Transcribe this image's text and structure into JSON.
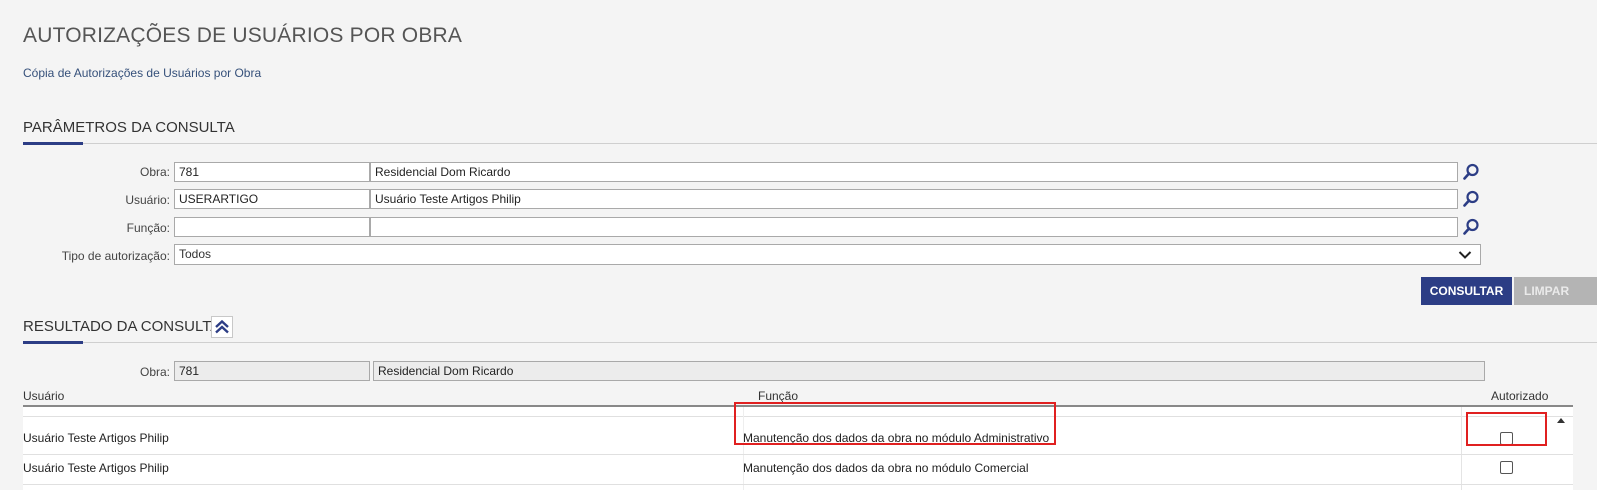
{
  "header": {
    "title": "AUTORIZAÇÕES DE USUÁRIOS POR OBRA",
    "subtitle_link": "Cópia de Autorizações de Usuários por Obra"
  },
  "params": {
    "section_title": "PARÂMETROS DA CONSULTA",
    "obra": {
      "label": "Obra:",
      "code": "781",
      "description": "Residencial Dom Ricardo"
    },
    "usuario": {
      "label": "Usuário:",
      "code": "USERARTIGO",
      "description": "Usuário Teste Artigos Philip"
    },
    "funcao": {
      "label": "Função:",
      "code": "",
      "description": ""
    },
    "tipo": {
      "label": "Tipo de autorização:",
      "selected": "Todos"
    },
    "buttons": {
      "consultar": "CONSULTAR",
      "limpar": "LIMPAR"
    }
  },
  "result": {
    "section_title": "RESULTADO DA CONSULTA",
    "obra": {
      "label": "Obra:",
      "code": "781",
      "description": "Residencial Dom Ricardo"
    },
    "columns": {
      "usuario": "Usuário",
      "funcao": "Função",
      "autorizado": "Autorizado"
    },
    "rows": [
      {
        "usuario": "Usuário Teste Artigos Philip",
        "funcao": "Manutenção dos dados da obra no módulo Administrativo",
        "autorizado": false
      },
      {
        "usuario": "Usuário Teste Artigos Philip",
        "funcao": "Manutenção dos dados da obra no módulo Comercial",
        "autorizado": false
      }
    ]
  },
  "colors": {
    "primary": "#2c3d85",
    "highlight": "#e02020"
  }
}
